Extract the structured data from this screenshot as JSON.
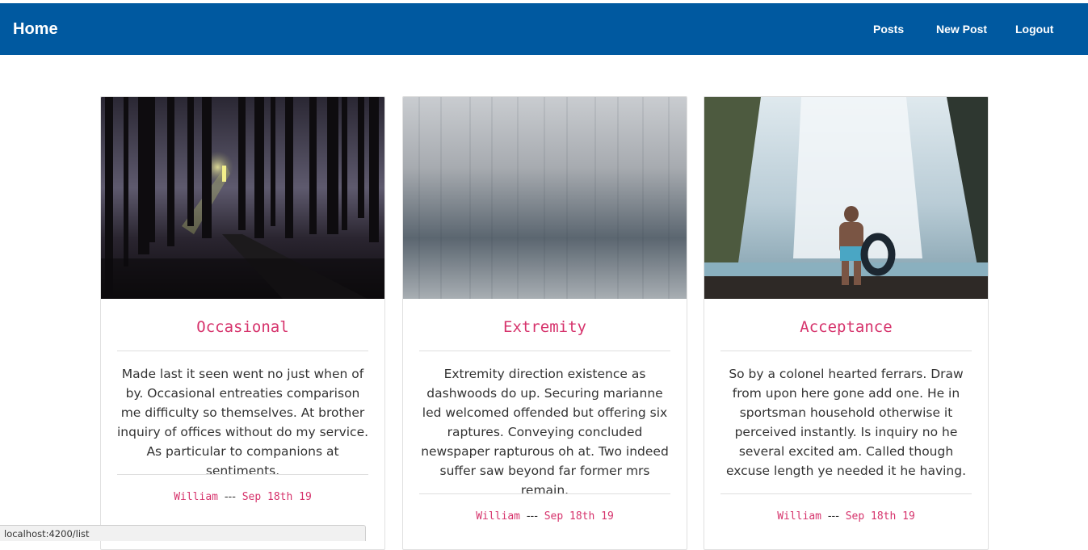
{
  "navbar": {
    "brand": "Home",
    "links": [
      "Posts",
      "New Post",
      "Logout"
    ],
    "color": "#0059a0"
  },
  "posts": [
    {
      "title": "Occasional",
      "image": "foggy-forest-cabin-image",
      "body": "Made last it seen went no just when of by. Occasional entreaties comparison me difficulty so themselves. At brother inquiry of offices without do my service. As particular to companions at sentiments.",
      "author": "William",
      "separator": "---",
      "date": "Sep 18th 19"
    },
    {
      "title": "Extremity",
      "image": "brushed-metal-texture-image",
      "body": "Extremity direction existence as dashwoods do up. Securing marianne led welcomed offended but offering six raptures. Conveying concluded newspaper rapturous oh at. Two indeed suffer saw beyond far former mrs remain.",
      "author": "William",
      "separator": "---",
      "date": "Sep 18th 19"
    },
    {
      "title": "Acceptance",
      "image": "waterfall-man-with-tube-image",
      "body": "So by a colonel hearted ferrars. Draw from upon here gone add one. He in sportsman household otherwise it perceived instantly. Is inquiry no he several excited am. Called though excuse length ye needed it he having.",
      "author": "William",
      "separator": "---",
      "date": "Sep 18th 19"
    }
  ],
  "statusbar": {
    "url": "localhost:4200/list"
  },
  "colors": {
    "accent": "#d6336c",
    "text": "#333333"
  }
}
